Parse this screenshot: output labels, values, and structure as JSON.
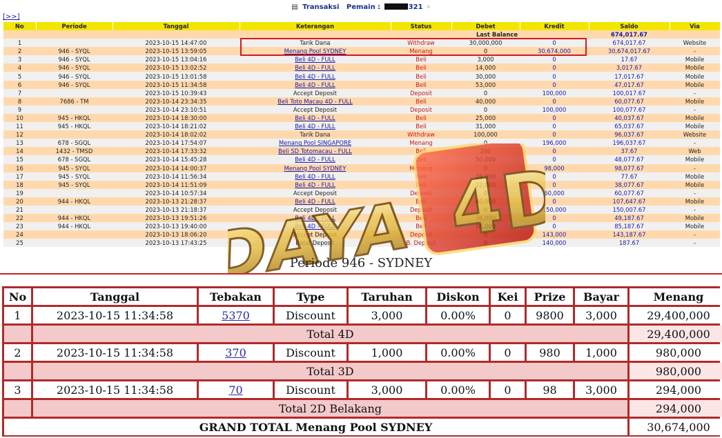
{
  "header": {
    "title_prefix": "Transaksi",
    "player_label": "Pemain :",
    "player_suffix": "321",
    "nav_link": "[>>]"
  },
  "table": {
    "columns": [
      "No",
      "Periode",
      "Tanggal",
      "Keterangan",
      "Status",
      "Debet",
      "Kredit",
      "Saldo",
      "Via"
    ],
    "last_balance_label": "Last Balance",
    "last_balance_value": "674,017.67",
    "rows": [
      {
        "no": "1",
        "periode": "",
        "tanggal": "2023-10-15 14:47:00",
        "ket": "Tarik Dana",
        "ket_link": false,
        "status": "Withdraw",
        "debet": "30,000,000",
        "kredit": "0",
        "saldo": "674,017.67",
        "via": "Website"
      },
      {
        "no": "2",
        "periode": "946 - SYQL",
        "tanggal": "2023-10-15 13:59:05",
        "ket": "Menang Pool SYDNEY",
        "ket_link": true,
        "status": "Menang",
        "debet": "0",
        "kredit": "30,674,000",
        "saldo": "30,674,017.67",
        "via": "-"
      },
      {
        "no": "3",
        "periode": "946 - SYQL",
        "tanggal": "2023-10-15 13:04:16",
        "ket": "Beli 4D - FULL",
        "ket_link": true,
        "status": "Beli",
        "debet": "3,000",
        "kredit": "0",
        "saldo": "17.67",
        "via": "Mobile"
      },
      {
        "no": "4",
        "periode": "946 - SYQL",
        "tanggal": "2023-10-15 13:02:52",
        "ket": "Beli 4D - FULL",
        "ket_link": true,
        "status": "Beli",
        "debet": "14,000",
        "kredit": "0",
        "saldo": "3,017.67",
        "via": "Mobile"
      },
      {
        "no": "5",
        "periode": "946 - SYQL",
        "tanggal": "2023-10-15 13:01:58",
        "ket": "Beli 4D - FULL",
        "ket_link": true,
        "status": "Beli",
        "debet": "30,000",
        "kredit": "0",
        "saldo": "17,017.67",
        "via": "Mobile"
      },
      {
        "no": "6",
        "periode": "946 - SYQL",
        "tanggal": "2023-10-15 11:34:58",
        "ket": "Beli 4D - FULL",
        "ket_link": true,
        "status": "Beli",
        "debet": "53,000",
        "kredit": "0",
        "saldo": "47,017.67",
        "via": "Mobile"
      },
      {
        "no": "7",
        "periode": "",
        "tanggal": "2023-10-15 10:39:43",
        "ket": "Accept Deposit",
        "ket_link": false,
        "status": "Deposit",
        "debet": "0",
        "kredit": "100,000",
        "saldo": "100,017.67",
        "via": "-"
      },
      {
        "no": "8",
        "periode": "7686 - TM",
        "tanggal": "2023-10-14 23:34:35",
        "ket": "Beli Toto Macau 4D - FULL",
        "ket_link": true,
        "status": "Beli",
        "debet": "40,000",
        "kredit": "0",
        "saldo": "60,077.67",
        "via": "Mobile"
      },
      {
        "no": "9",
        "periode": "",
        "tanggal": "2023-10-14 23:10:51",
        "ket": "Accept Deposit",
        "ket_link": false,
        "status": "Deposit",
        "debet": "0",
        "kredit": "100,000",
        "saldo": "100,077.67",
        "via": "-"
      },
      {
        "no": "10",
        "periode": "945 - HKQL",
        "tanggal": "2023-10-14 18:30:00",
        "ket": "Beli 4D - FULL",
        "ket_link": true,
        "status": "Beli",
        "debet": "25,000",
        "kredit": "0",
        "saldo": "40,037.67",
        "via": "Mobile"
      },
      {
        "no": "11",
        "periode": "945 - HKQL",
        "tanggal": "2023-10-14 18:21:02",
        "ket": "Beli 4D - FULL",
        "ket_link": true,
        "status": "Beli",
        "debet": "31,000",
        "kredit": "0",
        "saldo": "65,037.67",
        "via": "Mobile"
      },
      {
        "no": "12",
        "periode": "",
        "tanggal": "2023-10-14 18:02:02",
        "ket": "Tarik Dana",
        "ket_link": false,
        "status": "Withdraw",
        "debet": "100,000",
        "kredit": "0",
        "saldo": "96,037.67",
        "via": "Website"
      },
      {
        "no": "13",
        "periode": "678 - SGQL",
        "tanggal": "2023-10-14 17:54:07",
        "ket": "Menang Pool SINGAPORE",
        "ket_link": true,
        "status": "Menang",
        "debet": "0",
        "kredit": "196,000",
        "saldo": "196,037.67",
        "via": "-"
      },
      {
        "no": "14",
        "periode": "1432 - TMSD",
        "tanggal": "2023-10-14 17:33:32",
        "ket": "Beli SD Totomacau - FULL",
        "ket_link": true,
        "status": "Beli",
        "debet": "200",
        "kredit": "0",
        "saldo": "37.67",
        "via": "Web"
      },
      {
        "no": "15",
        "periode": "678 - SGQL",
        "tanggal": "2023-10-14 15:45:28",
        "ket": "Beli 4D - FULL",
        "ket_link": true,
        "status": "Beli",
        "debet": "50,000",
        "kredit": "0",
        "saldo": "48,077.67",
        "via": "Mobile"
      },
      {
        "no": "16",
        "periode": "945 - SYQL",
        "tanggal": "2023-10-14 14:00:37",
        "ket": "Menang Pool SYDNEY",
        "ket_link": true,
        "status": "Menang",
        "debet": "0",
        "kredit": "98,000",
        "saldo": "98,077.67",
        "via": "-"
      },
      {
        "no": "17",
        "periode": "945 - SYQL",
        "tanggal": "2023-10-14 11:56:34",
        "ket": "Beli 4D - FULL",
        "ket_link": true,
        "status": "Beli",
        "debet": "38,000",
        "kredit": "0",
        "saldo": "77.67",
        "via": "Mobile"
      },
      {
        "no": "18",
        "periode": "945 - SYQL",
        "tanggal": "2023-10-14 11:51:09",
        "ket": "Beli 4D - FULL",
        "ket_link": true,
        "status": "Beli",
        "debet": "22,000",
        "kredit": "0",
        "saldo": "38,077.67",
        "via": "Mobile"
      },
      {
        "no": "19",
        "periode": "",
        "tanggal": "2023-10-14 10:57:34",
        "ket": "Accept Deposit",
        "ket_link": false,
        "status": "Deposit",
        "debet": "0",
        "kredit": "60,000",
        "saldo": "60,077.67",
        "via": "-"
      },
      {
        "no": "20",
        "periode": "944 - HKQL",
        "tanggal": "2023-10-13 21:28:37",
        "ket": "Beli 4D - FULL",
        "ket_link": true,
        "status": "Beli",
        "debet": "40,000",
        "kredit": "0",
        "saldo": "107,647.67",
        "via": "Mobile"
      },
      {
        "no": "21",
        "periode": "",
        "tanggal": "2023-10-13 21:18:37",
        "ket": "Accept Deposit",
        "ket_link": false,
        "status": "Deposit",
        "debet": "0",
        "kredit": "150,000",
        "saldo": "150,007.67",
        "via": "-"
      },
      {
        "no": "22",
        "periode": "944 - HKQL",
        "tanggal": "2023-10-13 19:51:26",
        "ket": "Beli 4D - FULL",
        "ket_link": true,
        "status": "Beli",
        "debet": "36,000",
        "kredit": "0",
        "saldo": "49,187.67",
        "via": "Mobile"
      },
      {
        "no": "23",
        "periode": "944 - HKQL",
        "tanggal": "2023-10-13 19:40:00",
        "ket": "Beli 4D - FULL",
        "ket_link": true,
        "status": "Beli",
        "debet": "58,000",
        "kredit": "0",
        "saldo": "85,187.67",
        "via": "Mobile"
      },
      {
        "no": "24",
        "periode": "",
        "tanggal": "2023-10-13 18:06:20",
        "ket": "Accept Deposit",
        "ket_link": false,
        "status": "Deposit",
        "debet": "0",
        "kredit": "143,000",
        "saldo": "143,187.67",
        "via": "-"
      },
      {
        "no": "25",
        "periode": "",
        "tanggal": "2023-10-13 17:43:25",
        "ket": "Batal Deposit",
        "ket_link": false,
        "status": "B. Deposit",
        "debet": "0",
        "kredit": "140,000",
        "saldo": "187.67",
        "via": "-"
      }
    ]
  },
  "watermark_text": "DAYA 4D",
  "periode": {
    "title": "Periode 946 - SYDNEY",
    "columns": [
      "No",
      "Tanggal",
      "Tebakan",
      "Type",
      "Taruhan",
      "Diskon",
      "Kei",
      "Prize",
      "Bayar",
      "Menang"
    ],
    "groups": [
      {
        "no": "1",
        "tanggal": "2023-10-15 11:34:58",
        "tebakan": "5370",
        "type": "Discount",
        "taruhan": "3,000",
        "diskon": "0.00%",
        "kei": "0",
        "prize": "9800",
        "bayar": "3,000",
        "menang": "29,400,000",
        "total_label": "Total 4D",
        "total_value": "29,400,000"
      },
      {
        "no": "2",
        "tanggal": "2023-10-15 11:34:58",
        "tebakan": "370",
        "type": "Discount",
        "taruhan": "1,000",
        "diskon": "0.00%",
        "kei": "0",
        "prize": "980",
        "bayar": "1,000",
        "menang": "980,000",
        "total_label": "Total 3D",
        "total_value": "980,000"
      },
      {
        "no": "3",
        "tanggal": "2023-10-15 11:34:58",
        "tebakan": "70",
        "type": "Discount",
        "taruhan": "3,000",
        "diskon": "0.00%",
        "kei": "0",
        "prize": "98",
        "bayar": "3,000",
        "menang": "294,000",
        "total_label": "Total 2D Belakang",
        "total_value": "294,000"
      }
    ],
    "grand_total_label": "GRAND TOTAL  Menang Pool SYDNEY",
    "grand_total_value": "30,674,000"
  }
}
